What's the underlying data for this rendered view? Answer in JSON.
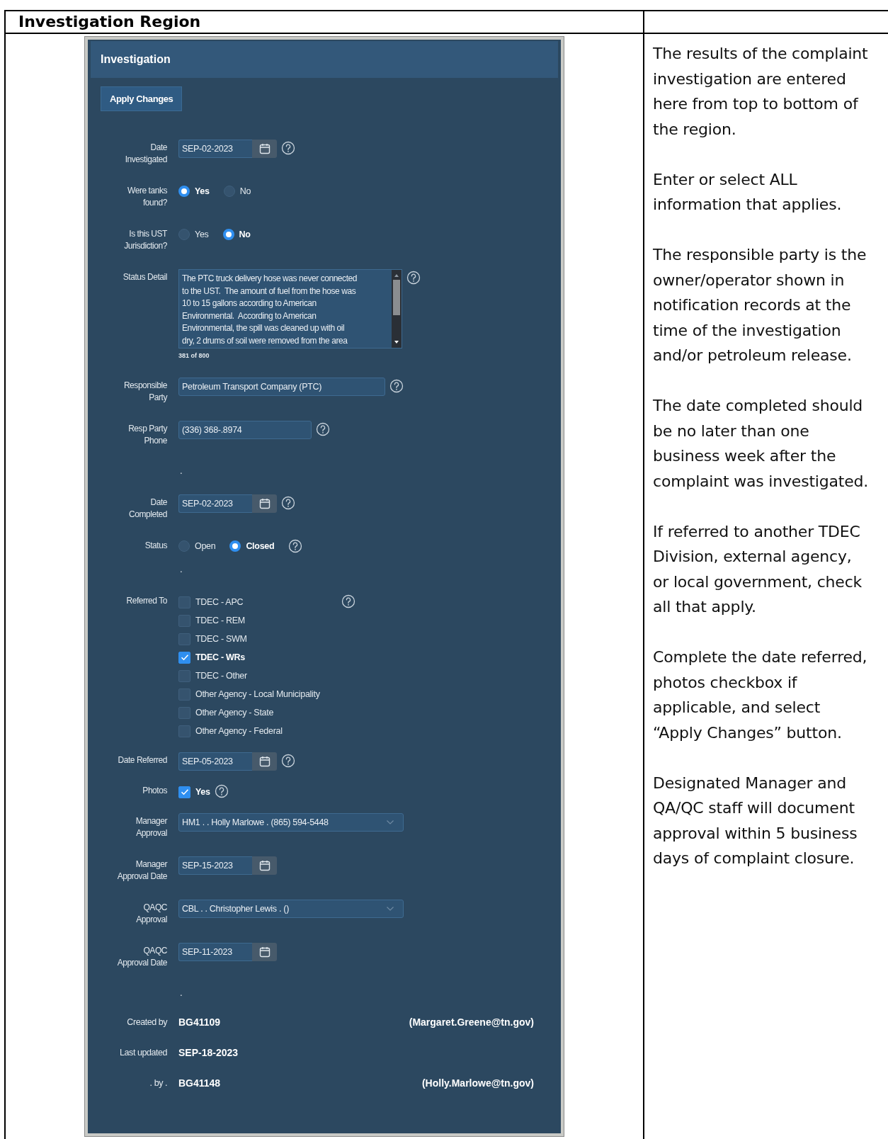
{
  "document": {
    "heading": "Investigation Region",
    "notes": [
      "The results of the complaint investigation are entered here from top to bottom of the region.",
      "Enter or select ALL information that applies.",
      "The responsible party is the owner/operator shown in notification records at the time of the investigation and/or petroleum release.",
      "The date completed should be no later than one business week after the complaint was investigated.",
      "If referred to another TDEC Division, external agency, or local government, check all that apply.",
      "Complete the date referred, photos checkbox if applicable, and select “Apply Changes” button.",
      "Designated Manager and QA/QC staff will document approval within 5 business days of complaint closure."
    ]
  },
  "panel": {
    "title": "Investigation",
    "apply_button": "Apply Changes",
    "rows": [
      {
        "kind": "date",
        "label": "Date Investigated",
        "value": "SEP-02-2023",
        "help": true
      },
      {
        "kind": "radio",
        "label": "Were tanks found?",
        "options": [
          {
            "label": "Yes",
            "selected": true
          },
          {
            "label": "No",
            "selected": false
          }
        ],
        "help": false
      },
      {
        "kind": "radio",
        "label": "Is this UST Jurisdiction?",
        "options": [
          {
            "label": "Yes",
            "selected": false
          },
          {
            "label": "No",
            "selected": true
          }
        ],
        "help": false
      },
      {
        "kind": "textarea",
        "label": "Status Detail",
        "lines": [
          "The PTC truck delivery hose was never connected",
          "to the UST.  The amount of fuel from the hose was",
          "10 to 15 gallons according to American",
          "Environmental.  According to American",
          "Environmental, the spill was cleaned up with oil",
          "dry, 2 drums of soil were removed from the area"
        ],
        "counter": "381 of 800",
        "help": true
      },
      {
        "kind": "wide_text",
        "label": "Responsible Party",
        "value": "Petroleum Transport Company (PTC)",
        "help": true
      },
      {
        "kind": "text",
        "label": "Resp Party Phone",
        "value": "(336) 368-.8974",
        "help": true
      },
      {
        "kind": "dot",
        "text": "."
      },
      {
        "kind": "date",
        "label": "Date Completed",
        "value": "SEP-02-2023",
        "help": true
      },
      {
        "kind": "radio",
        "label": "Status",
        "options": [
          {
            "label": "Open",
            "selected": false
          },
          {
            "label": "Closed",
            "selected": true
          }
        ],
        "help": true
      },
      {
        "kind": "dot",
        "text": "."
      },
      {
        "kind": "checklist",
        "label": "Referred To",
        "options": [
          {
            "label": "TDEC - APC",
            "checked": false
          },
          {
            "label": "TDEC - REM",
            "checked": false
          },
          {
            "label": "TDEC - SWM",
            "checked": false
          },
          {
            "label": "TDEC - WRs",
            "checked": true
          },
          {
            "label": "TDEC - Other",
            "checked": false
          },
          {
            "label": "Other Agency - Local Municipality",
            "checked": false
          },
          {
            "label": "Other Agency - State",
            "checked": false
          },
          {
            "label": "Other Agency - Federal",
            "checked": false
          }
        ],
        "help": true
      },
      {
        "kind": "date",
        "label": "Date Referred",
        "value": "SEP-05-2023",
        "help": true
      },
      {
        "kind": "checklist",
        "label": "Photos",
        "options": [
          {
            "label": "Yes",
            "checked": true
          }
        ],
        "help": true
      },
      {
        "kind": "select",
        "label": "Manager Approval",
        "value": "HM1 . . Holly Marlowe . (865) 594-5448",
        "help": false
      },
      {
        "kind": "date",
        "label": "Manager Approval Date",
        "value": "SEP-15-2023",
        "help": false
      },
      {
        "kind": "select",
        "label": "QAQC Approval",
        "value": "CBL . . Christopher Lewis . ()",
        "help": false
      },
      {
        "kind": "date",
        "label": "QAQC Approval Date",
        "value": "SEP-11-2023",
        "help": false
      },
      {
        "kind": "dot",
        "text": "."
      },
      {
        "kind": "info",
        "label": "Created by",
        "value": "BG41109",
        "email": "(Margaret.Greene@tn.gov)"
      },
      {
        "kind": "info",
        "label": "Last updated",
        "value": "SEP-18-2023"
      },
      {
        "kind": "info",
        "label": ". by .",
        "value": "BG41148",
        "email": "(Holly.Marlowe@tn.gov)"
      }
    ]
  }
}
